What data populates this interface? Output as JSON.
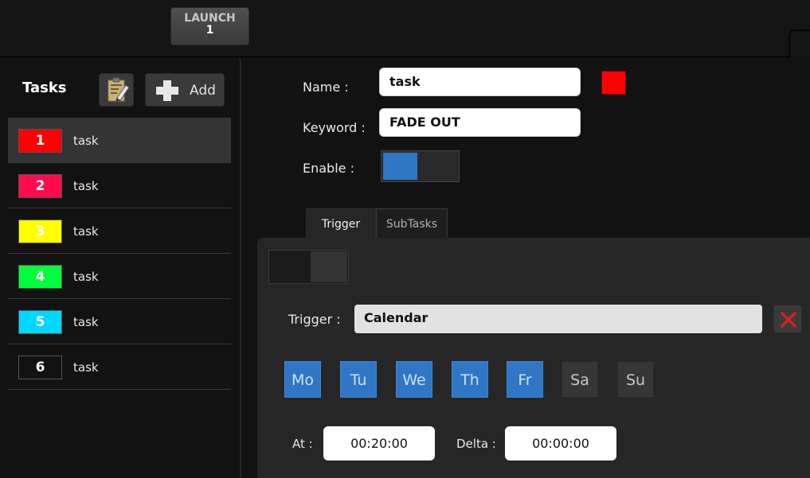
{
  "launch": {
    "line1": "LAUNCH",
    "line2": "1"
  },
  "sidebar": {
    "title": "Tasks",
    "add_label": "Add",
    "tasks": [
      {
        "num": "1",
        "label": "task",
        "color": "#ff0000",
        "text_color": "#ffffff",
        "selected": true
      },
      {
        "num": "2",
        "label": "task",
        "color": "#ff0a4d",
        "text_color": "#ffffff",
        "selected": false
      },
      {
        "num": "3",
        "label": "task",
        "color": "#ffff00",
        "text_color": "#ffffff",
        "selected": false
      },
      {
        "num": "4",
        "label": "task",
        "color": "#00ff3c",
        "text_color": "#ffffff",
        "selected": false
      },
      {
        "num": "5",
        "label": "task",
        "color": "#00d8ff",
        "text_color": "#ffffff",
        "selected": false
      },
      {
        "num": "6",
        "label": "task",
        "color": "#121212",
        "text_color": "#ffffff",
        "selected": false
      }
    ]
  },
  "form": {
    "name_label": "Name :",
    "name_value": "task",
    "name_color": "#ff0000",
    "keyword_label": "Keyword :",
    "keyword_value": "FADE OUT",
    "enable_label": "Enable :",
    "enabled": true
  },
  "tabs": [
    {
      "label": "Trigger",
      "active": true
    },
    {
      "label": "SubTasks",
      "active": false
    }
  ],
  "trigger": {
    "label": "Trigger :",
    "value": "Calendar",
    "days": [
      {
        "label": "Mo",
        "on": true
      },
      {
        "label": "Tu",
        "on": true
      },
      {
        "label": "We",
        "on": true
      },
      {
        "label": "Th",
        "on": true
      },
      {
        "label": "Fr",
        "on": true
      },
      {
        "label": "Sa",
        "on": false
      },
      {
        "label": "Su",
        "on": false
      }
    ],
    "at_label": "At :",
    "at_value": "00:20:00",
    "delta_label": "Delta :",
    "delta_value": "00:00:00"
  },
  "colors": {
    "accent": "#2f76c5",
    "clear_icon": "#d42020"
  }
}
